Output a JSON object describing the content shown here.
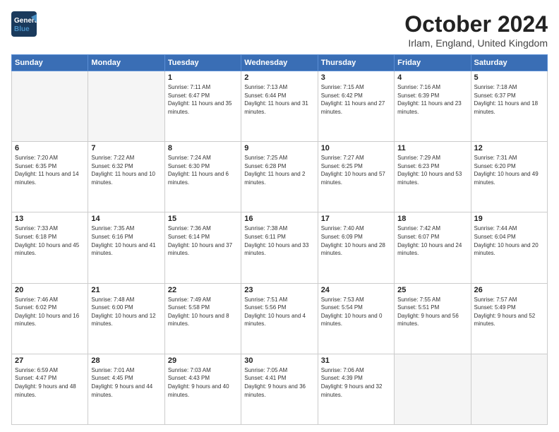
{
  "header": {
    "logo_line1": "General",
    "logo_line2": "Blue",
    "month_title": "October 2024",
    "location": "Irlam, England, United Kingdom"
  },
  "days_of_week": [
    "Sunday",
    "Monday",
    "Tuesday",
    "Wednesday",
    "Thursday",
    "Friday",
    "Saturday"
  ],
  "weeks": [
    [
      {
        "day": "",
        "info": ""
      },
      {
        "day": "",
        "info": ""
      },
      {
        "day": "1",
        "info": "Sunrise: 7:11 AM\nSunset: 6:47 PM\nDaylight: 11 hours and 35 minutes."
      },
      {
        "day": "2",
        "info": "Sunrise: 7:13 AM\nSunset: 6:44 PM\nDaylight: 11 hours and 31 minutes."
      },
      {
        "day": "3",
        "info": "Sunrise: 7:15 AM\nSunset: 6:42 PM\nDaylight: 11 hours and 27 minutes."
      },
      {
        "day": "4",
        "info": "Sunrise: 7:16 AM\nSunset: 6:39 PM\nDaylight: 11 hours and 23 minutes."
      },
      {
        "day": "5",
        "info": "Sunrise: 7:18 AM\nSunset: 6:37 PM\nDaylight: 11 hours and 18 minutes."
      }
    ],
    [
      {
        "day": "6",
        "info": "Sunrise: 7:20 AM\nSunset: 6:35 PM\nDaylight: 11 hours and 14 minutes."
      },
      {
        "day": "7",
        "info": "Sunrise: 7:22 AM\nSunset: 6:32 PM\nDaylight: 11 hours and 10 minutes."
      },
      {
        "day": "8",
        "info": "Sunrise: 7:24 AM\nSunset: 6:30 PM\nDaylight: 11 hours and 6 minutes."
      },
      {
        "day": "9",
        "info": "Sunrise: 7:25 AM\nSunset: 6:28 PM\nDaylight: 11 hours and 2 minutes."
      },
      {
        "day": "10",
        "info": "Sunrise: 7:27 AM\nSunset: 6:25 PM\nDaylight: 10 hours and 57 minutes."
      },
      {
        "day": "11",
        "info": "Sunrise: 7:29 AM\nSunset: 6:23 PM\nDaylight: 10 hours and 53 minutes."
      },
      {
        "day": "12",
        "info": "Sunrise: 7:31 AM\nSunset: 6:20 PM\nDaylight: 10 hours and 49 minutes."
      }
    ],
    [
      {
        "day": "13",
        "info": "Sunrise: 7:33 AM\nSunset: 6:18 PM\nDaylight: 10 hours and 45 minutes."
      },
      {
        "day": "14",
        "info": "Sunrise: 7:35 AM\nSunset: 6:16 PM\nDaylight: 10 hours and 41 minutes."
      },
      {
        "day": "15",
        "info": "Sunrise: 7:36 AM\nSunset: 6:14 PM\nDaylight: 10 hours and 37 minutes."
      },
      {
        "day": "16",
        "info": "Sunrise: 7:38 AM\nSunset: 6:11 PM\nDaylight: 10 hours and 33 minutes."
      },
      {
        "day": "17",
        "info": "Sunrise: 7:40 AM\nSunset: 6:09 PM\nDaylight: 10 hours and 28 minutes."
      },
      {
        "day": "18",
        "info": "Sunrise: 7:42 AM\nSunset: 6:07 PM\nDaylight: 10 hours and 24 minutes."
      },
      {
        "day": "19",
        "info": "Sunrise: 7:44 AM\nSunset: 6:04 PM\nDaylight: 10 hours and 20 minutes."
      }
    ],
    [
      {
        "day": "20",
        "info": "Sunrise: 7:46 AM\nSunset: 6:02 PM\nDaylight: 10 hours and 16 minutes."
      },
      {
        "day": "21",
        "info": "Sunrise: 7:48 AM\nSunset: 6:00 PM\nDaylight: 10 hours and 12 minutes."
      },
      {
        "day": "22",
        "info": "Sunrise: 7:49 AM\nSunset: 5:58 PM\nDaylight: 10 hours and 8 minutes."
      },
      {
        "day": "23",
        "info": "Sunrise: 7:51 AM\nSunset: 5:56 PM\nDaylight: 10 hours and 4 minutes."
      },
      {
        "day": "24",
        "info": "Sunrise: 7:53 AM\nSunset: 5:54 PM\nDaylight: 10 hours and 0 minutes."
      },
      {
        "day": "25",
        "info": "Sunrise: 7:55 AM\nSunset: 5:51 PM\nDaylight: 9 hours and 56 minutes."
      },
      {
        "day": "26",
        "info": "Sunrise: 7:57 AM\nSunset: 5:49 PM\nDaylight: 9 hours and 52 minutes."
      }
    ],
    [
      {
        "day": "27",
        "info": "Sunrise: 6:59 AM\nSunset: 4:47 PM\nDaylight: 9 hours and 48 minutes."
      },
      {
        "day": "28",
        "info": "Sunrise: 7:01 AM\nSunset: 4:45 PM\nDaylight: 9 hours and 44 minutes."
      },
      {
        "day": "29",
        "info": "Sunrise: 7:03 AM\nSunset: 4:43 PM\nDaylight: 9 hours and 40 minutes."
      },
      {
        "day": "30",
        "info": "Sunrise: 7:05 AM\nSunset: 4:41 PM\nDaylight: 9 hours and 36 minutes."
      },
      {
        "day": "31",
        "info": "Sunrise: 7:06 AM\nSunset: 4:39 PM\nDaylight: 9 hours and 32 minutes."
      },
      {
        "day": "",
        "info": ""
      },
      {
        "day": "",
        "info": ""
      }
    ]
  ]
}
